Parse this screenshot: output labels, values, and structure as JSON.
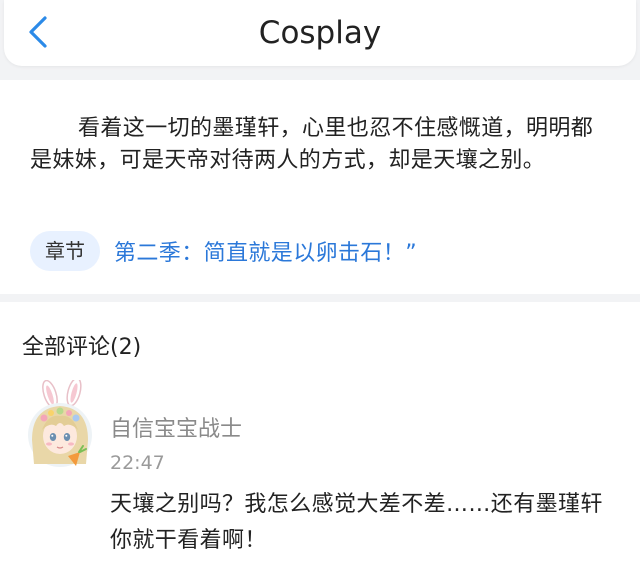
{
  "header": {
    "title": "Cosplay",
    "back_icon": "chevron-left-icon",
    "accent_color": "#2b8ae8"
  },
  "article": {
    "quote": "看着这一切的墨瑾轩，心里也忍不住感慨道，明明都是妹妹，可是天帝对待两人的方式，却是天壤之别。",
    "chapter_badge": "章节",
    "chapter_title": "第二季：简直就是以卵击石！”",
    "chapter_color": "#2b78d9"
  },
  "comments": {
    "header": "全部评论(2)",
    "items": [
      {
        "username": "自信宝宝战士",
        "time": "22:47",
        "text": "天壤之别吗？我怎么感觉大差不差……还有墨瑾轩你就干看着啊！",
        "avatar_icon": "bunny-girl-avatar"
      }
    ]
  }
}
